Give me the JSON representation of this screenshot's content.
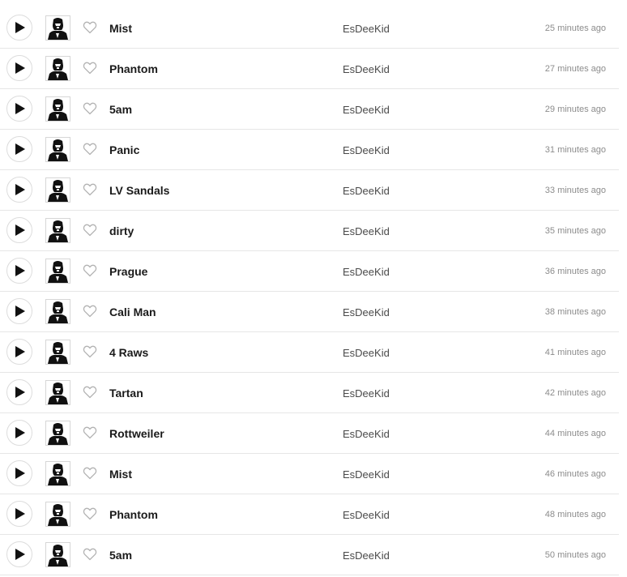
{
  "icons": {
    "play": "play-icon",
    "like": "heart-outline-icon",
    "artwork": "artist-avatar"
  },
  "colors": {
    "text_primary": "#1a1a1a",
    "text_secondary": "#4a4a4a",
    "text_muted": "#8c8c8c",
    "divider": "#e6e6e6"
  },
  "tracks": [
    {
      "title": "Mist",
      "artist": "EsDeeKid",
      "time": "25 minutes ago"
    },
    {
      "title": "Phantom",
      "artist": "EsDeeKid",
      "time": "27 minutes ago"
    },
    {
      "title": "5am",
      "artist": "EsDeeKid",
      "time": "29 minutes ago"
    },
    {
      "title": "Panic",
      "artist": "EsDeeKid",
      "time": "31 minutes ago"
    },
    {
      "title": "LV Sandals",
      "artist": "EsDeeKid",
      "time": "33 minutes ago"
    },
    {
      "title": "dirty",
      "artist": "EsDeeKid",
      "time": "35 minutes ago"
    },
    {
      "title": "Prague",
      "artist": "EsDeeKid",
      "time": "36 minutes ago"
    },
    {
      "title": "Cali Man",
      "artist": "EsDeeKid",
      "time": "38 minutes ago"
    },
    {
      "title": "4 Raws",
      "artist": "EsDeeKid",
      "time": "41 minutes ago"
    },
    {
      "title": "Tartan",
      "artist": "EsDeeKid",
      "time": "42 minutes ago"
    },
    {
      "title": "Rottweiler",
      "artist": "EsDeeKid",
      "time": "44 minutes ago"
    },
    {
      "title": "Mist",
      "artist": "EsDeeKid",
      "time": "46 minutes ago"
    },
    {
      "title": "Phantom",
      "artist": "EsDeeKid",
      "time": "48 minutes ago"
    },
    {
      "title": "5am",
      "artist": "EsDeeKid",
      "time": "50 minutes ago"
    }
  ]
}
